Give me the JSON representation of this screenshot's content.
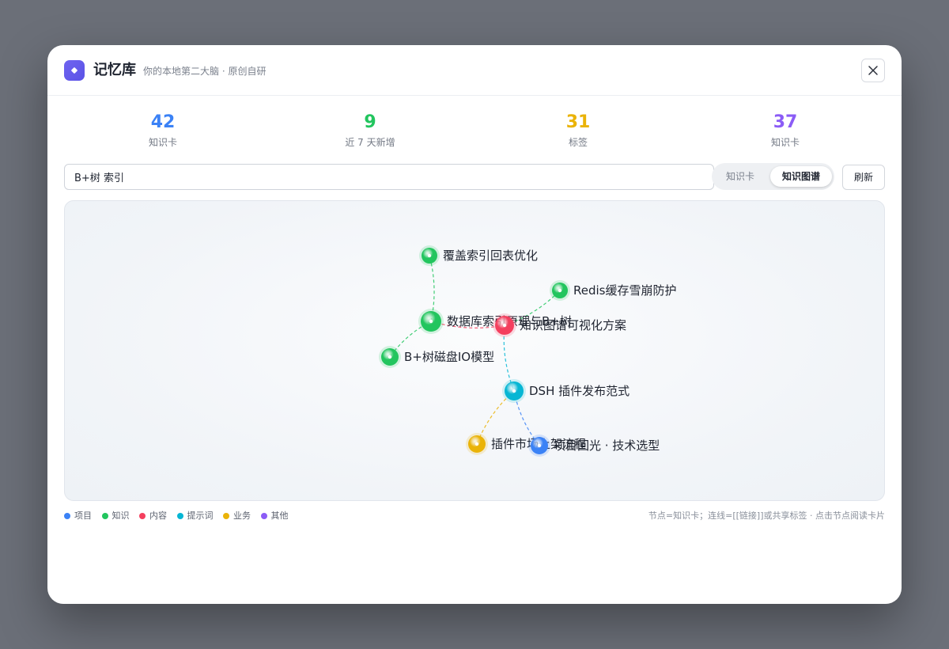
{
  "app": {
    "title": "记忆库",
    "subtitle": "你的本地第二大脑 · 原创自研"
  },
  "stats": [
    {
      "value": "42",
      "label": "知识卡",
      "color": "#3b82f6"
    },
    {
      "value": "9",
      "label": "近 7 天新增",
      "color": "#22c55e"
    },
    {
      "value": "31",
      "label": "标签",
      "color": "#eab308"
    },
    {
      "value": "37",
      "label": "知识卡",
      "color": "#8b5cf6"
    }
  ],
  "search": {
    "value": "B+树 索引"
  },
  "view_toggle": {
    "cards_label": "知识卡",
    "graph_label": "知识图谱",
    "active": "graph"
  },
  "refresh_label": "刷新",
  "graph": {
    "nodes": [
      {
        "id": "n1",
        "label": "覆盖索引回表优化",
        "category": "knowledge"
      },
      {
        "id": "n2",
        "label": "Redis缓存雪崩防护",
        "category": "knowledge"
      },
      {
        "id": "n3",
        "label": "数据库索引原理与B+树",
        "category": "knowledge"
      },
      {
        "id": "n4",
        "label": "知识图谱可视化方案",
        "category": "content"
      },
      {
        "id": "n5",
        "label": "B+树磁盘IO模型",
        "category": "knowledge"
      },
      {
        "id": "n6",
        "label": "DSH 插件发布范式",
        "category": "prompt"
      },
      {
        "id": "n7",
        "label": "插件市场上架流程",
        "category": "business"
      },
      {
        "id": "n8",
        "label": "项目回光 · 技术选型",
        "category": "project"
      }
    ],
    "edges": [
      {
        "from": "n3",
        "to": "n1"
      },
      {
        "from": "n3",
        "to": "n5"
      },
      {
        "from": "n3",
        "to": "n4"
      },
      {
        "from": "n4",
        "to": "n2"
      },
      {
        "from": "n4",
        "to": "n6"
      },
      {
        "from": "n6",
        "to": "n7"
      },
      {
        "from": "n6",
        "to": "n8"
      }
    ]
  },
  "legend": [
    {
      "key": "project",
      "label": "项目",
      "color": "#3b82f6"
    },
    {
      "key": "knowledge",
      "label": "知识",
      "color": "#22c55e"
    },
    {
      "key": "content",
      "label": "内容",
      "color": "#f43f5e"
    },
    {
      "key": "prompt",
      "label": "提示词",
      "color": "#06b6d4"
    },
    {
      "key": "business",
      "label": "业务",
      "color": "#eab308"
    },
    {
      "key": "other",
      "label": "其他",
      "color": "#8b5cf6"
    }
  ],
  "hint": "节点=知识卡；连线=[[链接]]或共享标签 · 点击节点阅读卡片"
}
